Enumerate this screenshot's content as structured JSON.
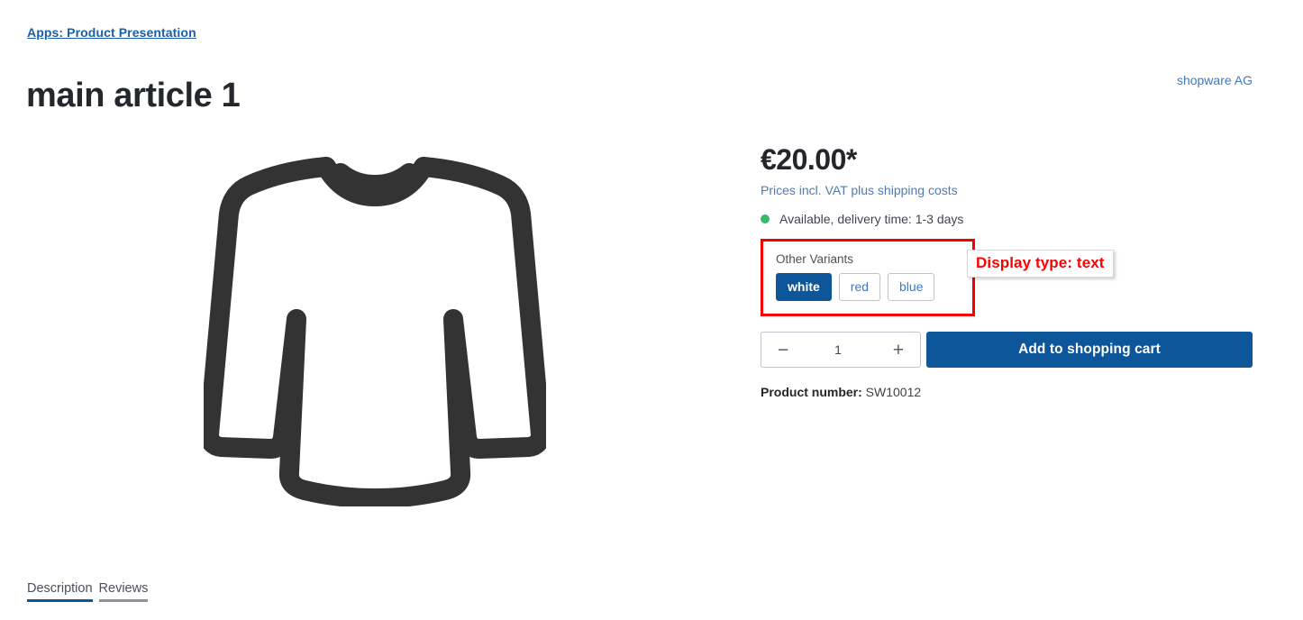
{
  "header": {
    "breadcrumb": "Apps: Product Presentation",
    "title": "main article 1",
    "manufacturer": "shopware AG"
  },
  "gallery": {
    "image_alt": "sweater-placeholder-icon",
    "stroke_color": "#333333"
  },
  "buy_box": {
    "price": "€20.00*",
    "tax_note": "Prices incl. VAT plus shipping costs",
    "availability": "Available, delivery time: 1-3 days",
    "availability_dot_color": "#37ba6b",
    "variants": {
      "label": "Other Variants",
      "options": [
        {
          "label": "white",
          "selected": true
        },
        {
          "label": "red",
          "selected": false
        },
        {
          "label": "blue",
          "selected": false
        }
      ]
    },
    "quantity": {
      "decrease_label": "−",
      "increase_label": "+",
      "value": "1"
    },
    "add_to_cart_label": "Add to shopping cart",
    "product_number_label": "Product number:",
    "product_number_value": "SW10012"
  },
  "annotation": {
    "text": "Display type: text",
    "color": "#fd0000"
  },
  "tabs": [
    {
      "label": "Description",
      "active": true
    },
    {
      "label": "Reviews",
      "active": false
    }
  ],
  "colors": {
    "brand_blue": "#0d5699",
    "link_blue": "#3c7ac0",
    "breadcrumb_blue": "#1a5fa8",
    "annotation_red": "#f40000",
    "available_green": "#37ba6b"
  }
}
